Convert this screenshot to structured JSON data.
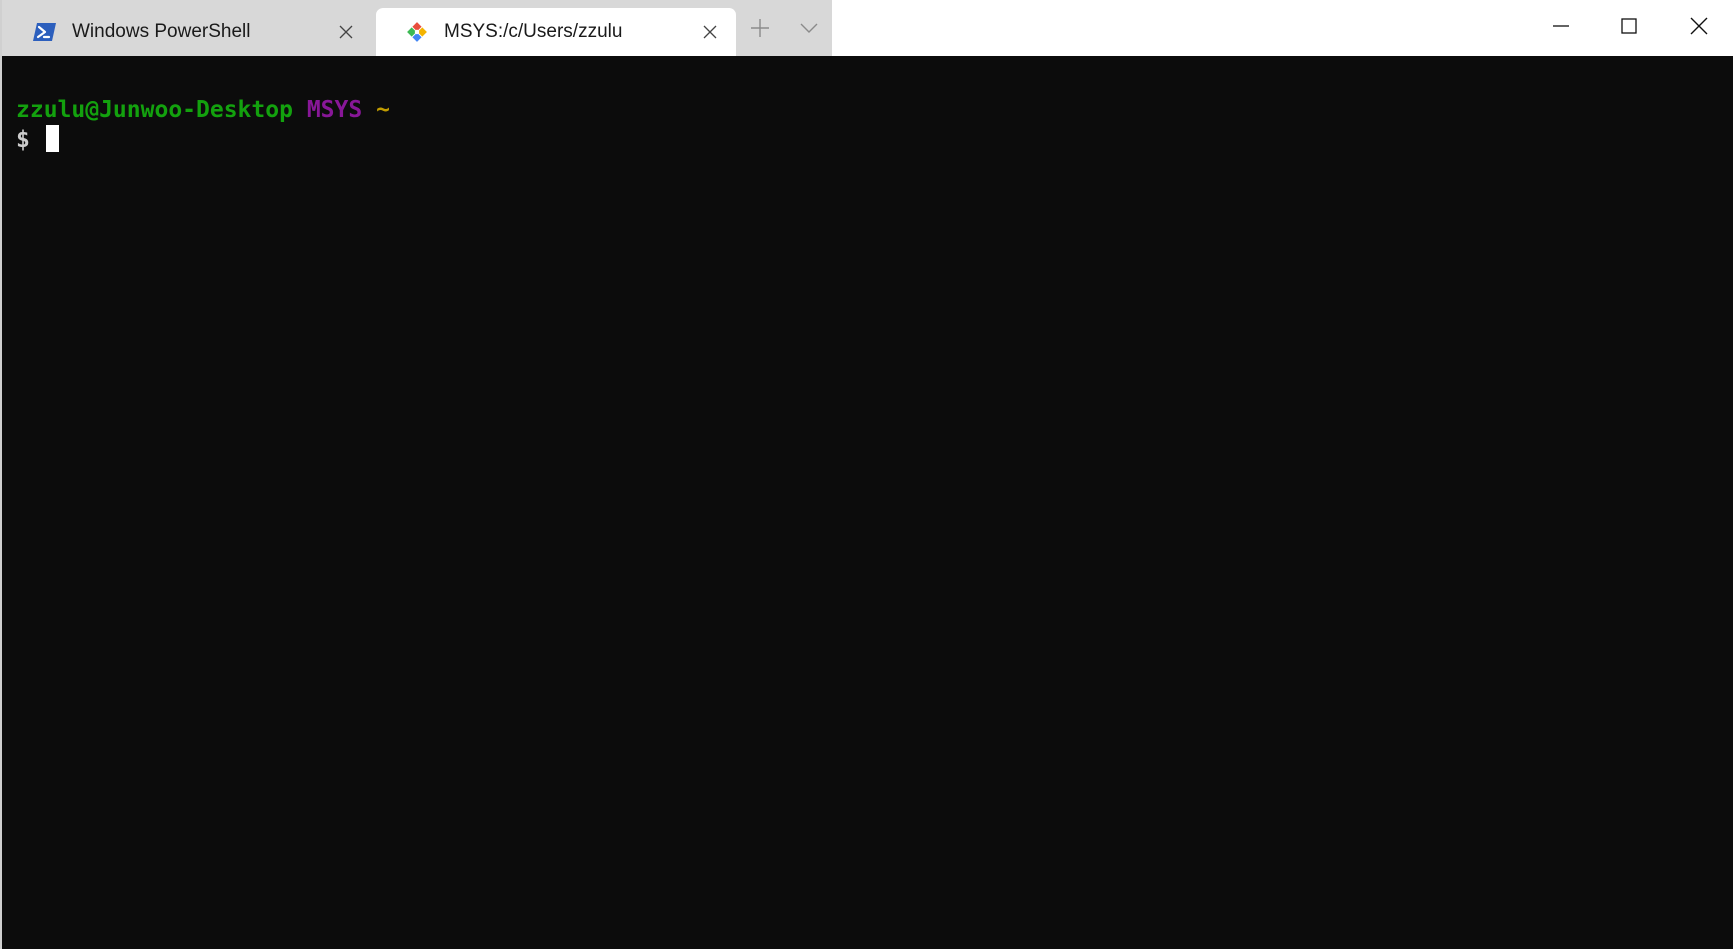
{
  "tabs": [
    {
      "label": "Windows PowerShell",
      "icon": "powershell-icon",
      "active": false
    },
    {
      "label": "MSYS:/c/Users/zzulu",
      "icon": "git-icon",
      "active": true
    }
  ],
  "titlebar": {
    "new_tab_icon": "plus-icon",
    "dropdown_icon": "chevron-down-icon",
    "minimize_icon": "minimize-icon",
    "maximize_icon": "maximize-icon",
    "close_icon": "close-icon"
  },
  "terminal": {
    "user_host": "zzulu@Junwoo-Desktop",
    "env": "MSYS",
    "path": "~",
    "prompt": "$",
    "colors": {
      "background": "#0c0c0c",
      "user_host": "#13a10e",
      "env": "#881798",
      "path": "#c19c00",
      "prompt": "#cccccc"
    }
  }
}
